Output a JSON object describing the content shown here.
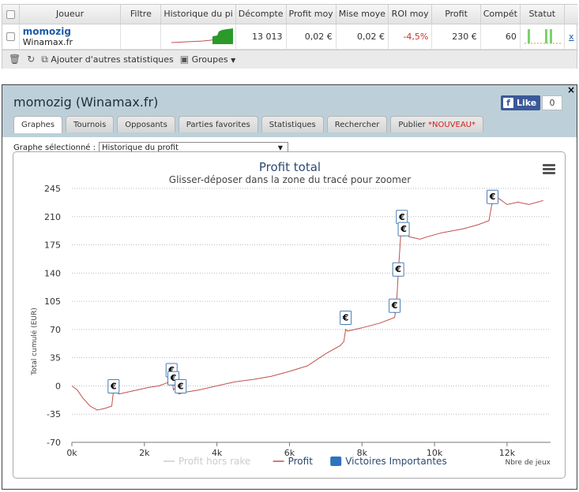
{
  "table": {
    "headers": [
      "Joueur",
      "Filtre",
      "Historique du pi",
      "Décompte",
      "Profit moy",
      "Mise moye",
      "ROI moy",
      "Profit",
      "Compét",
      "Statut"
    ],
    "row": {
      "name": "momozig",
      "site": "Winamax.fr",
      "decompte": "13 013",
      "profit_moy": "0,02 €",
      "mise_moy": "0,02 €",
      "roi": "-4,5%",
      "profit": "230 €",
      "competitions": "60",
      "remove": "x"
    },
    "toolbar": {
      "add_stats": "Ajouter d'autres statistiques",
      "groups": "Groupes"
    }
  },
  "panel": {
    "title": "momozig (Winamax.fr)",
    "close": "×",
    "like_label": "Like",
    "like_count": "0",
    "tabs": [
      {
        "label": "Graphes",
        "active": true
      },
      {
        "label": "Tournois"
      },
      {
        "label": "Opposants"
      },
      {
        "label": "Parties favorites"
      },
      {
        "label": "Statistiques"
      },
      {
        "label": "Rechercher"
      },
      {
        "label": "Publier",
        "badge": "*NOUVEAU*"
      }
    ],
    "select_label": "Graphe sélectionné :",
    "select_value": "Historique du profit"
  },
  "colors": {
    "profit_line": "#c0504d",
    "flag_border": "#4a7db5",
    "legend_blue": "#2f72c0",
    "title": "#2b4a6f"
  },
  "chart_data": {
    "type": "line",
    "title": "Profit total",
    "subtitle": "Glisser-déposer dans la zone du tracé pour zoomer",
    "xlabel": "Nbre de jeux",
    "ylabel": "Total cumulé (EUR)",
    "xlim": [
      0,
      13200
    ],
    "ylim": [
      -70,
      245
    ],
    "xticks": [
      0,
      2000,
      4000,
      6000,
      8000,
      10000,
      12000
    ],
    "xtick_labels": [
      "0k",
      "2k",
      "4k",
      "6k",
      "8k",
      "10k",
      "12k"
    ],
    "yticks": [
      -70,
      -35,
      0,
      35,
      70,
      105,
      140,
      175,
      210,
      245
    ],
    "legend": [
      {
        "name": "Profit hors rake",
        "hidden": true
      },
      {
        "name": "Profit"
      },
      {
        "name": "Victoires Importantes"
      }
    ],
    "series": [
      {
        "name": "Profit",
        "x": [
          0,
          150,
          300,
          500,
          700,
          900,
          1100,
          1150,
          1300,
          1500,
          1800,
          2100,
          2400,
          2700,
          2750,
          2800,
          2900,
          2950,
          3100,
          3500,
          4000,
          4500,
          5000,
          5500,
          6000,
          6500,
          7000,
          7400,
          7500,
          7550,
          7600,
          8000,
          8500,
          8900,
          8950,
          9000,
          9050,
          9100,
          9150,
          9300,
          9600,
          9800,
          10200,
          10800,
          11200,
          11500,
          11600,
          11700,
          12000,
          12300,
          12600,
          13000
        ],
        "y": [
          0,
          -5,
          -15,
          -25,
          -30,
          -28,
          -25,
          -5,
          -10,
          -8,
          -5,
          -2,
          0,
          5,
          15,
          -5,
          0,
          -10,
          -8,
          -5,
          0,
          5,
          8,
          12,
          18,
          25,
          40,
          50,
          55,
          70,
          68,
          72,
          78,
          85,
          100,
          140,
          175,
          210,
          190,
          185,
          182,
          185,
          190,
          195,
          200,
          205,
          230,
          235,
          225,
          228,
          225,
          230
        ]
      },
      {
        "name": "Victoires Importantes",
        "x": [
          1150,
          2750,
          2800,
          3000,
          7550,
          8900,
          9000,
          9100,
          9150,
          11600
        ],
        "y": [
          0,
          20,
          10,
          0,
          85,
          100,
          145,
          210,
          195,
          235
        ]
      }
    ]
  }
}
